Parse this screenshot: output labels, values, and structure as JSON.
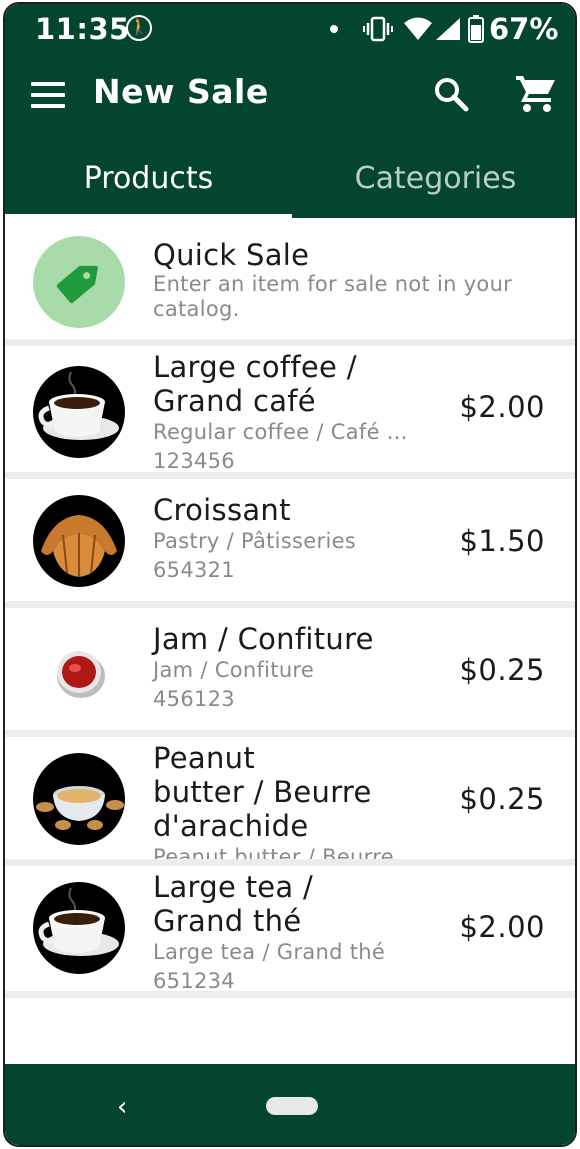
{
  "status_bar": {
    "time": "11:35",
    "battery": "67%"
  },
  "app_bar": {
    "title": "New Sale",
    "icons": [
      "menu-icon",
      "search-icon",
      "cart-icon"
    ]
  },
  "tabs": [
    {
      "label": "Products",
      "selected": true
    },
    {
      "label": "Categories",
      "selected": false
    }
  ],
  "quick_sale": {
    "title": "Quick Sale",
    "description_line1": "Enter an item for sale not in your",
    "description_line2": "catalog."
  },
  "products": [
    {
      "name_line1": "Large coffee /",
      "name_line2": "Grand café",
      "category": "Regular coffee / Café ...",
      "sku": "123456",
      "price": "$2.00",
      "icon": "coffee-cup"
    },
    {
      "name_line1": "Croissant",
      "category": "Pastry / Pâtisseries",
      "sku": "654321",
      "price": "$1.50",
      "icon": "croissant"
    },
    {
      "name_line1": "Jam / Confiture",
      "category": "Jam / Confiture",
      "sku": "456123",
      "price": "$0.25",
      "icon": "jam-cup"
    },
    {
      "name_line1": "Peanut",
      "name_line2": "butter / Beurre",
      "name_line3": "d'arachide",
      "category": "Peanut butter / Beurre",
      "price": "$0.25",
      "icon": "peanut-butter"
    },
    {
      "name_line1": "Large tea /",
      "name_line2": "Grand thé",
      "category": "Large tea / Grand thé",
      "sku": "651234",
      "price": "$2.00",
      "icon": "tea-cup"
    }
  ],
  "colors": {
    "primary": "#03452f",
    "quick_sale_avatar": "#a9dba8",
    "tag_icon": "#1f9a3c",
    "secondary_text": "#8a8a8a"
  }
}
